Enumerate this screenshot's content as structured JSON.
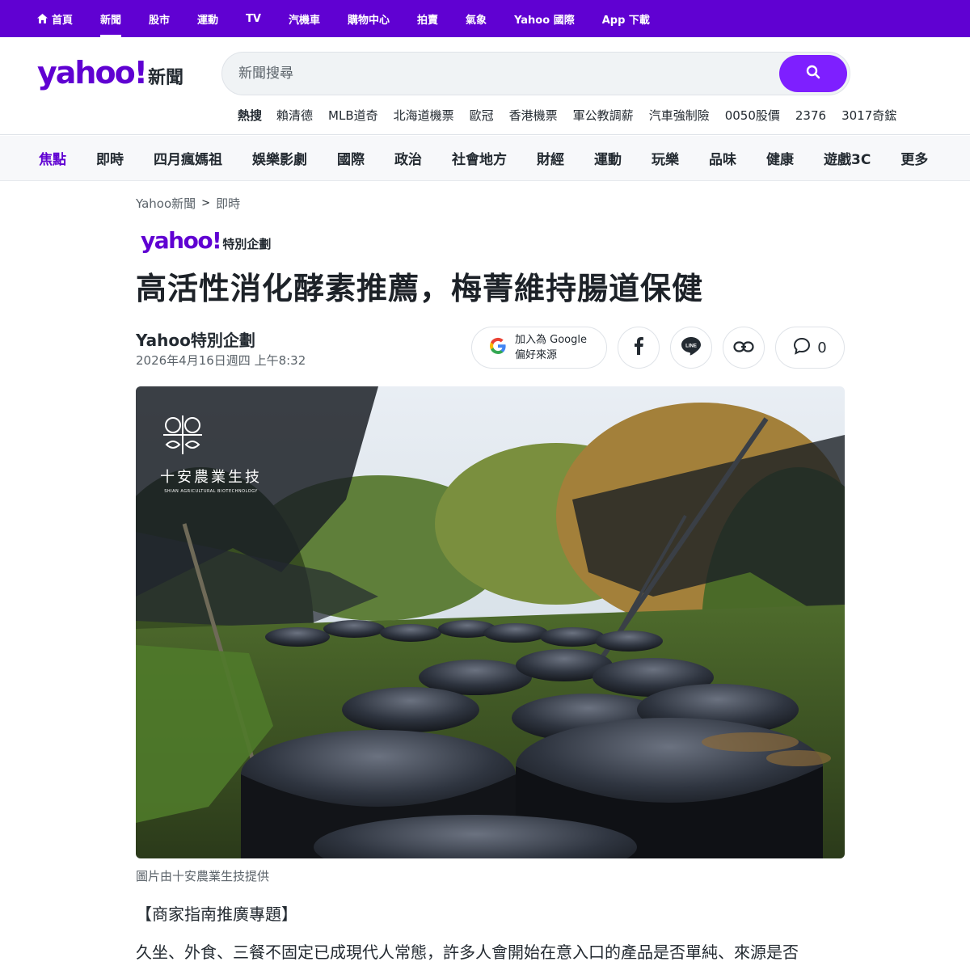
{
  "topbar": {
    "items": [
      {
        "label": "首頁",
        "icon": "home-icon"
      },
      {
        "label": "新聞"
      },
      {
        "label": "股市"
      },
      {
        "label": "運動"
      },
      {
        "label": "TV"
      },
      {
        "label": "汽機車"
      },
      {
        "label": "購物中心"
      },
      {
        "label": "拍賣"
      },
      {
        "label": "氣象"
      },
      {
        "label": "Yahoo 國際"
      },
      {
        "label": "App 下載"
      }
    ],
    "active": "新聞",
    "color": "#6001d2"
  },
  "header": {
    "logo_word": "yahoo!",
    "logo_suffix": "新聞",
    "search_placeholder": "新聞搜尋",
    "search_icon": "search-icon",
    "trending_label": "熱搜",
    "trending": [
      "賴清德",
      "MLB道奇",
      "北海道機票",
      "歐冠",
      "香港機票",
      "軍公教調薪",
      "汽車強制險",
      "0050股價",
      "2376",
      "3017奇鋐"
    ]
  },
  "catnav": {
    "items": [
      "焦點",
      "即時",
      "四月瘋媽祖",
      "娛樂影劇",
      "國際",
      "政治",
      "社會地方",
      "財經",
      "運動",
      "玩樂",
      "品味",
      "健康",
      "遊戲3C",
      "更多"
    ],
    "active": "焦點"
  },
  "article": {
    "breadcrumb": [
      "Yahoo新聞",
      "即時"
    ],
    "brand_word": "yahoo!",
    "brand_suffix": "特別企劃",
    "headline": "高活性消化酵素推薦，梅菁維持腸道保健",
    "author": "Yahoo特別企劃",
    "date": "2026年4月16日週四 上午8:32",
    "google_line1": "加入為 Google",
    "google_line2": "偏好來源",
    "comment_count": "0",
    "image_watermark": "十安農業生技",
    "image_watermark_sub": "SHIAN AGRICULTURAL BIOTECHNOLOGY",
    "caption": "圖片由十安農業生技提供",
    "section_tag": "【商家指南推廣專題】",
    "paragraph": "久坐、外食、三餐不固定已成現代人常態，許多人會開始在意入口的產品是否單純、來源是否"
  }
}
